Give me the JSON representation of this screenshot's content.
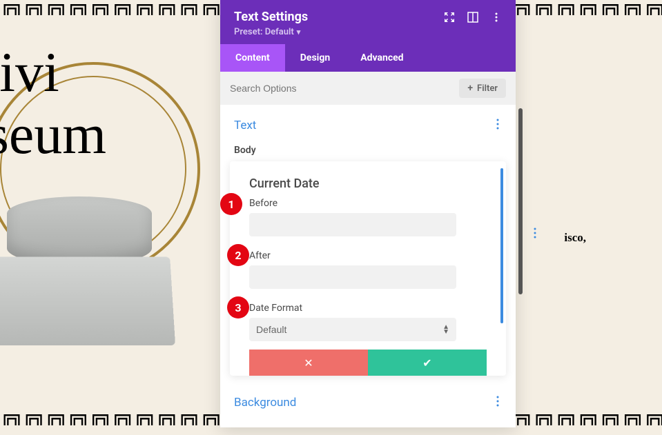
{
  "background": {
    "title_line1": "Divi",
    "title_line2": "useum",
    "right_text": "isco,"
  },
  "panel": {
    "title": "Text Settings",
    "preset_label": "Preset: Default",
    "tabs": {
      "content": "Content",
      "design": "Design",
      "advanced": "Advanced"
    },
    "search_placeholder": "Search Options",
    "filter_label": "Filter",
    "sections": {
      "text": {
        "title": "Text",
        "body_label": "Body"
      },
      "background": {
        "title": "Background"
      }
    }
  },
  "inner_card": {
    "title": "Current Date",
    "before": {
      "label": "Before",
      "value": ""
    },
    "after": {
      "label": "After",
      "value": ""
    },
    "date_format": {
      "label": "Date Format",
      "selected": "Default"
    }
  },
  "badges": {
    "b1": "1",
    "b2": "2",
    "b3": "3"
  },
  "icons": {
    "expand": "expand-icon",
    "columns": "columns-icon",
    "menu": "dots-vertical-icon",
    "plus": "+",
    "close": "✕",
    "check": "✔"
  }
}
